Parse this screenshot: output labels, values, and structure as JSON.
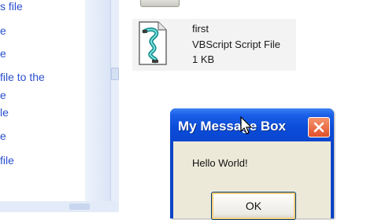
{
  "task_pane": {
    "links": [
      {
        "label": "s file"
      },
      {
        "label": "e"
      },
      {
        "label": "e"
      },
      {
        "label": "file to the"
      },
      {
        "label": "e"
      },
      {
        "label": "le"
      },
      {
        "label": "e"
      },
      {
        "label": "file"
      }
    ]
  },
  "file_list": {
    "items": [
      {
        "name": "first",
        "type": "VBScript Script File",
        "size": "1 KB",
        "icon": "vbscript-file-icon"
      }
    ]
  },
  "message_box": {
    "title": "My Message Box",
    "text": "Hello World!",
    "ok_label": "OK",
    "colors": {
      "titlebar": "#0a47cf",
      "close_button": "#e0502a",
      "client": "#ece9d8"
    }
  }
}
